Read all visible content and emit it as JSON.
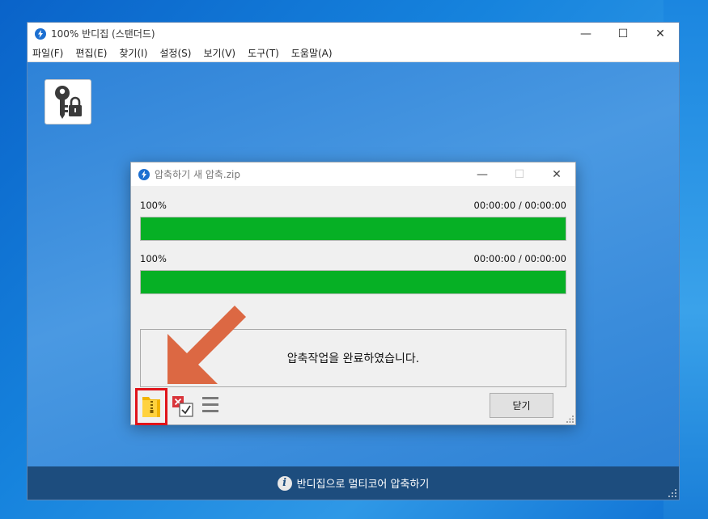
{
  "main_window": {
    "title": "100% 반디집 (스탠더드)",
    "controls": {
      "minimize": "—",
      "maximize": "☐",
      "close": "✕"
    },
    "menu": [
      {
        "label": "파일(F)"
      },
      {
        "label": "편집(E)"
      },
      {
        "label": "찾기(I)"
      },
      {
        "label": "설정(S)"
      },
      {
        "label": "보기(V)"
      },
      {
        "label": "도구(T)"
      },
      {
        "label": "도움말(A)"
      }
    ],
    "toolbar": {
      "password_icon": "key-lock-icon"
    },
    "statusbar": {
      "text": "반디집으로 멀티코어 압축하기",
      "icon": "i"
    }
  },
  "dialog": {
    "title": "압축하기 새 압축.zip",
    "controls": {
      "minimize": "—",
      "maximize": "☐",
      "close": "✕"
    },
    "progress": [
      {
        "percent_label": "100%",
        "time": "00:00:00 / 00:00:00",
        "value": 100
      },
      {
        "percent_label": "100%",
        "time": "00:00:00 / 00:00:00",
        "value": 100
      }
    ],
    "message": "압축작업을 완료하였습니다.",
    "close_label": "닫기",
    "colors": {
      "progress_fill": "#06b025",
      "highlight": "#e0141b",
      "arrow": "#dc6843"
    }
  }
}
